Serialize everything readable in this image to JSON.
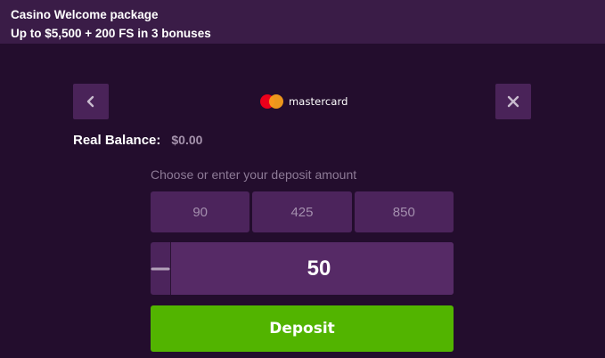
{
  "banner": {
    "title": "Casino Welcome package",
    "subtitle": "Up to $5,500 + 200 FS in 3 bonuses"
  },
  "header": {
    "payment_method": "mastercard",
    "back_icon": "chevron-left-icon",
    "close_icon": "close-icon"
  },
  "balance": {
    "label": "Real Balance:",
    "value": "$0.00"
  },
  "deposit": {
    "hint": "Choose or enter your deposit amount",
    "presets": [
      "90",
      "425",
      "850"
    ],
    "amount": "50",
    "button_label": "Deposit"
  },
  "colors": {
    "background": "#230d2d",
    "banner": "#3a1c47",
    "control": "#4c245c",
    "accent_green": "#52b400",
    "mastercard_red": "#eb001b",
    "mastercard_orange": "#f79e1b"
  }
}
